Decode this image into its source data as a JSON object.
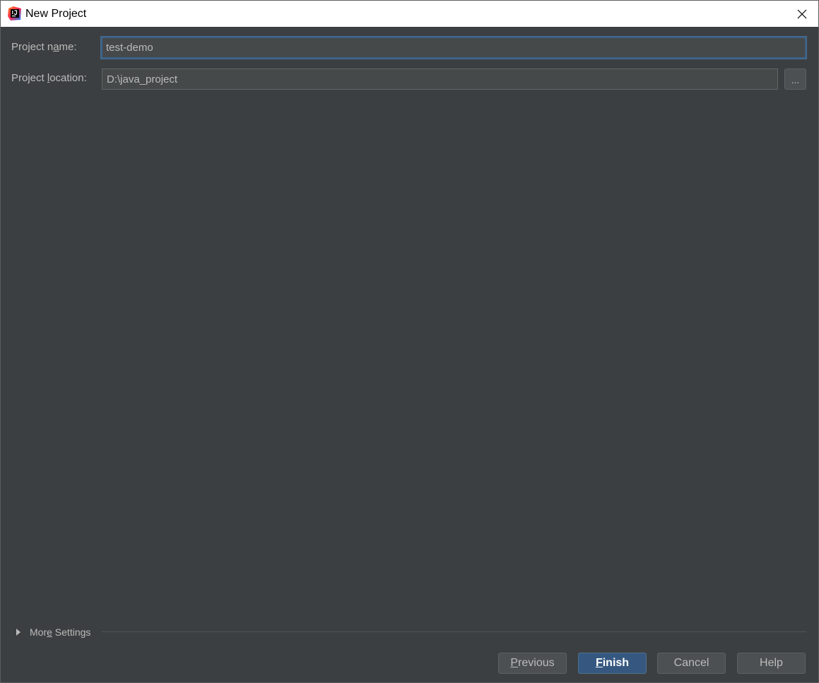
{
  "window": {
    "title": "New Project",
    "icon": "intellij-idea-icon",
    "close_icon": "close-icon"
  },
  "form": {
    "project_name": {
      "label_pre": "Project n",
      "label_mn": "a",
      "label_post": "me:",
      "value": "test-demo"
    },
    "project_location": {
      "label_pre": "Project ",
      "label_mn": "l",
      "label_post": "ocation:",
      "value": "D:\\java_project",
      "browse_label": "..."
    }
  },
  "more_settings": {
    "label_pre": "Mor",
    "label_mn": "e",
    "label_post": " Settings"
  },
  "buttons": {
    "previous": {
      "mn": "P",
      "rest": "revious"
    },
    "finish": {
      "mn": "F",
      "rest": "inish"
    },
    "cancel": "Cancel",
    "help": "Help"
  },
  "colors": {
    "background": "#3c3f41",
    "field_bg": "#45494a",
    "focus_border": "#3d6185",
    "default_button": "#365880",
    "text": "#bbbbbb"
  }
}
